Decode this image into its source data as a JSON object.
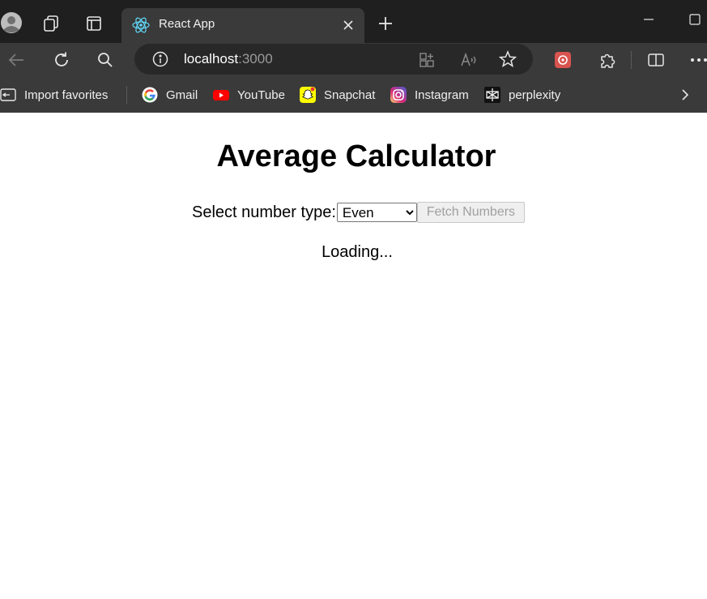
{
  "browser": {
    "tab": {
      "title": "React App"
    },
    "address": {
      "host": "localhost",
      "port": ":3000"
    },
    "bookmarks": [
      {
        "label": "Import favorites",
        "icon": "import-icon"
      },
      {
        "label": "Gmail",
        "icon": "google-icon"
      },
      {
        "label": "YouTube",
        "icon": "youtube-icon"
      },
      {
        "label": "Snapchat",
        "icon": "snapchat-icon"
      },
      {
        "label": "Instagram",
        "icon": "instagram-icon"
      },
      {
        "label": "perplexity",
        "icon": "perplexity-icon"
      }
    ]
  },
  "app": {
    "title": "Average Calculator",
    "select_label": "Select number type:",
    "select_value": "Even",
    "fetch_label": "Fetch Numbers",
    "status": "Loading..."
  },
  "colors": {
    "chrome_dark": "#1f1f1f",
    "chrome_bar": "#3a3a3a",
    "omnibox": "#282828",
    "youtube": "#ff0000",
    "snapchat": "#fffc00"
  }
}
